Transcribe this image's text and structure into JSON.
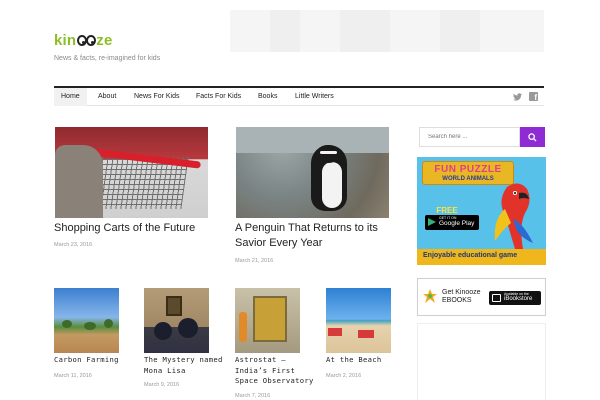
{
  "site": {
    "logo_left": "kin",
    "logo_right": "ze",
    "tagline": "News & facts, re-imagined for kids"
  },
  "nav": {
    "items": [
      {
        "label": "Home",
        "active": true
      },
      {
        "label": "About"
      },
      {
        "label": "News For Kids"
      },
      {
        "label": "Facts For Kids"
      },
      {
        "label": "Books"
      },
      {
        "label": "Little Writers"
      }
    ],
    "social": [
      "twitter-icon",
      "facebook-icon"
    ]
  },
  "featured": [
    {
      "title": "Shopping Carts of the Future",
      "date": "March 23, 2016"
    },
    {
      "title": "A Penguin That Returns to its Savior Every Year",
      "date": "March 21, 2016"
    }
  ],
  "posts": [
    {
      "title": "Carbon Farming",
      "date": "March 11, 2016"
    },
    {
      "title": "The Mystery named Mona Lisa",
      "date": "March 9, 2016"
    },
    {
      "title": "Astrostat – India’s First Space Observatory",
      "date": "March 7, 2016"
    },
    {
      "title": "At the Beach",
      "date": "March 2, 2016"
    }
  ],
  "sidebar": {
    "search_placeholder": "Search here ...",
    "ad_puzzle": {
      "title": "FUN PUZZLE",
      "subtitle": "WORLD ANIMALS",
      "free": "FREE",
      "store_sub": "GET IT ON",
      "store_main": "Google Play",
      "footer": "Enjoyable educational game"
    },
    "ebooks": {
      "line1": "Get Kinooze",
      "line2": "EBOOKS",
      "store_sub": "Available on the",
      "store_main": "iBookstore"
    }
  },
  "colors": {
    "brand_green": "#8cbf26",
    "accent_purple": "#8e2bd2",
    "text": "#222222",
    "muted": "#999999"
  }
}
